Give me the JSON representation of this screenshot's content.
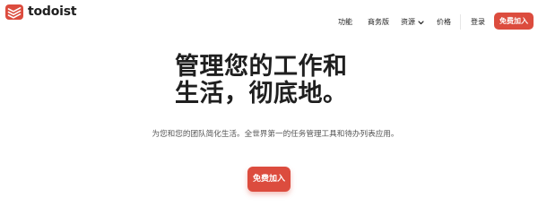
{
  "brand": {
    "name": "todoist",
    "logo_icon": "todoist-logo-icon",
    "accent_color": "#dc4c3e"
  },
  "nav": {
    "features": "功能",
    "business": "商务版",
    "resources": "资源",
    "pricing": "价格"
  },
  "header": {
    "login": "登录",
    "cta": "免费加入"
  },
  "hero": {
    "title_line1": "管理您的工作和",
    "title_line2": "生活，彻底地。",
    "subtitle": "为您和您的团队简化生活。全世界第一的任务管理工具和待办列表应用。",
    "cta": "免费加入"
  }
}
